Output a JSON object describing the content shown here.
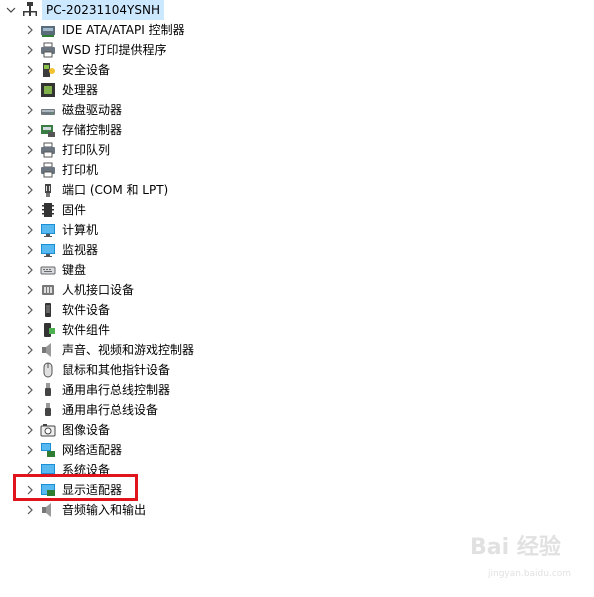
{
  "tree": {
    "root": {
      "label": "PC-20231104YSNH",
      "icon": "computer-icon",
      "expanded": true
    },
    "items": [
      {
        "label": "IDE ATA/ATAPI 控制器",
        "icon": "ide-controller-icon"
      },
      {
        "label": "WSD 打印提供程序",
        "icon": "printer-icon"
      },
      {
        "label": "安全设备",
        "icon": "security-device-icon"
      },
      {
        "label": "处理器",
        "icon": "processor-icon"
      },
      {
        "label": "磁盘驱动器",
        "icon": "disk-drive-icon"
      },
      {
        "label": "存储控制器",
        "icon": "storage-controller-icon"
      },
      {
        "label": "打印队列",
        "icon": "printer-icon"
      },
      {
        "label": "打印机",
        "icon": "printer-icon"
      },
      {
        "label": "端口 (COM 和 LPT)",
        "icon": "port-icon"
      },
      {
        "label": "固件",
        "icon": "firmware-icon"
      },
      {
        "label": "计算机",
        "icon": "monitor-icon"
      },
      {
        "label": "监视器",
        "icon": "monitor-icon"
      },
      {
        "label": "键盘",
        "icon": "keyboard-icon"
      },
      {
        "label": "人机接口设备",
        "icon": "hid-icon"
      },
      {
        "label": "软件设备",
        "icon": "software-device-icon"
      },
      {
        "label": "软件组件",
        "icon": "software-component-icon"
      },
      {
        "label": "声音、视频和游戏控制器",
        "icon": "speaker-icon"
      },
      {
        "label": "鼠标和其他指针设备",
        "icon": "mouse-icon"
      },
      {
        "label": "通用串行总线控制器",
        "icon": "usb-icon"
      },
      {
        "label": "通用串行总线设备",
        "icon": "usb-icon"
      },
      {
        "label": "图像设备",
        "icon": "camera-icon"
      },
      {
        "label": "网络适配器",
        "icon": "network-adapter-icon"
      },
      {
        "label": "系统设备",
        "icon": "system-device-icon"
      },
      {
        "label": "显示适配器",
        "icon": "display-adapter-icon"
      },
      {
        "label": "音频输入和输出",
        "icon": "audio-io-icon"
      }
    ]
  },
  "annotation": {
    "color": "#e0141c"
  },
  "watermark": {
    "text": "Bai 经验",
    "url": "jingyan.baidu.com"
  }
}
